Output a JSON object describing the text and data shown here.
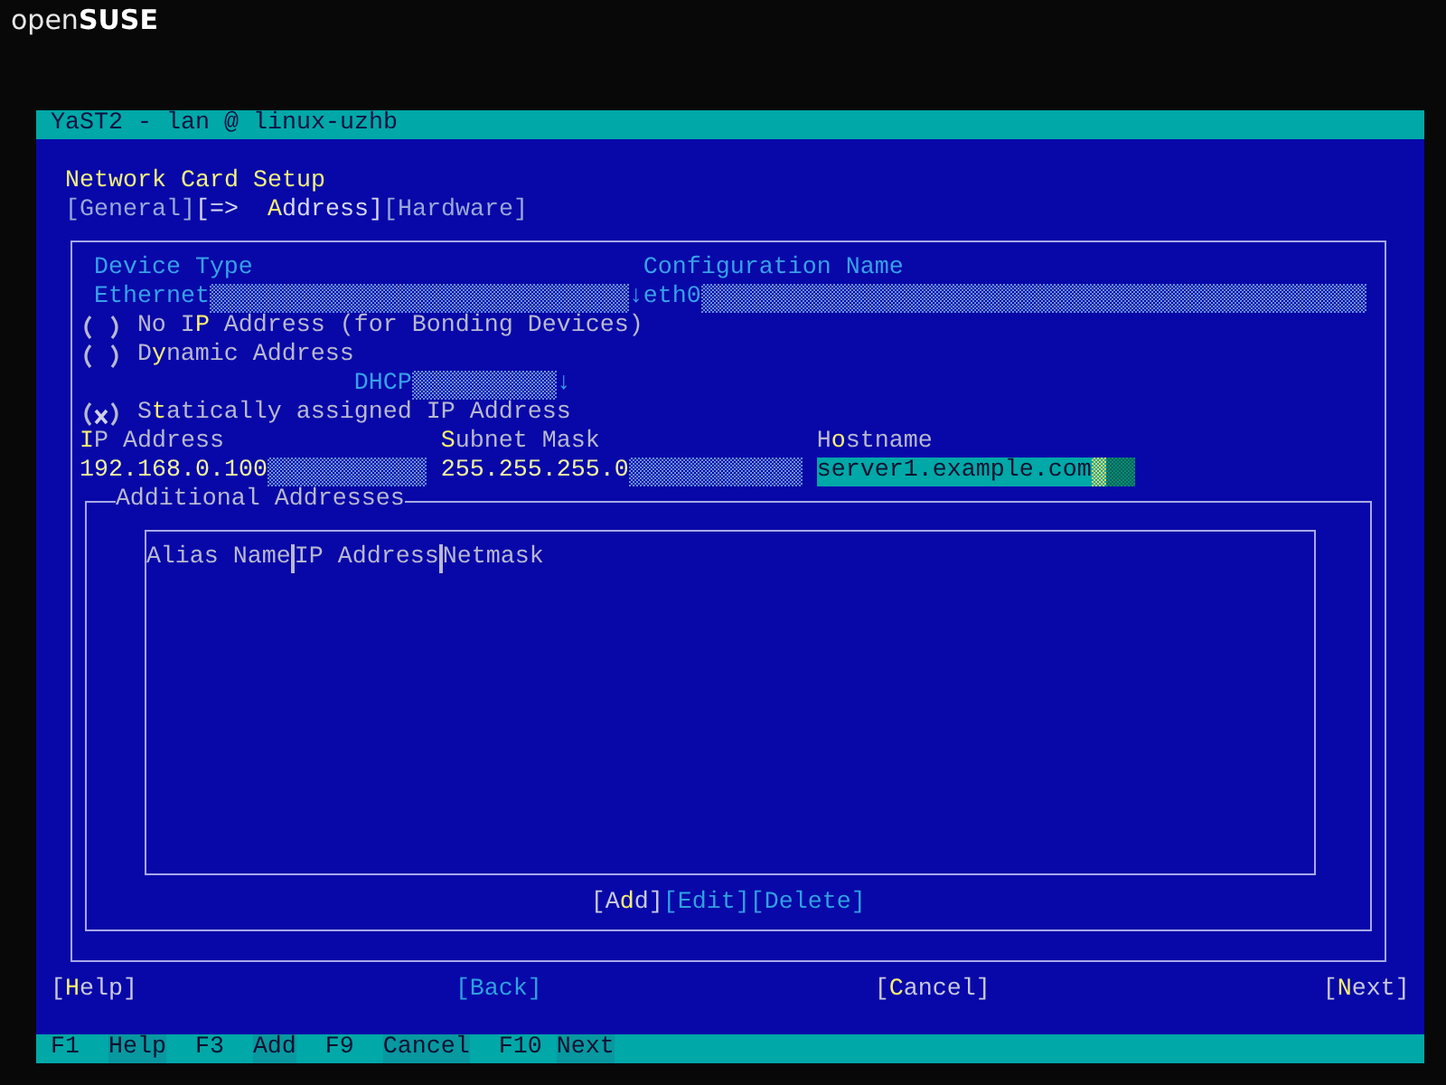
{
  "logo": "open**SUSE**",
  "window": {
    "title": "YaST2 - lan @ linux-uzhb"
  },
  "heading": "Network Card Setup",
  "tabs": [
    {
      "label": "[General]",
      "selected": false
    },
    {
      "label": "[=>  **A**ddress]",
      "selected": true
    },
    {
      "label": "[Hardware]",
      "selected": false
    }
  ],
  "device_type": {
    "label": "Device Type",
    "value": "Ethernet",
    "arrow": "↓"
  },
  "configuration_name": {
    "label": "Configuration Name",
    "value": "eth0"
  },
  "address_modes": [
    {
      "label": "No I**P** Address (for Bonding Devices)",
      "selected": false
    },
    {
      "label": "D**y**namic Address",
      "selected": false
    },
    {
      "label": "S**t**atically assigned IP Address",
      "selected": true
    }
  ],
  "dhcp": {
    "value": "DHCP",
    "arrow": "↓"
  },
  "ip_fields": [
    {
      "label": "**I**P Address",
      "value": "192.168.0.100",
      "focused": false
    },
    {
      "label": "**S**ubnet Mask",
      "value": "255.255.255.0",
      "focused": false
    },
    {
      "label": "H**o**stname",
      "value": "server1.example.com",
      "focused": true
    }
  ],
  "additional_addresses": {
    "title": "Additional Addresses",
    "columns": [
      "Alias Name",
      "IP Address",
      "Netmask"
    ],
    "buttons": [
      {
        "label": "[A**d**d]",
        "disabled": false
      },
      {
        "label": "[Edit]",
        "disabled": true
      },
      {
        "label": "[Delete]",
        "disabled": true
      }
    ]
  },
  "buttons": [
    {
      "label": "[**H**elp]",
      "disabled": false
    },
    {
      "label": "[Back]",
      "disabled": true
    },
    {
      "label": "[**C**ancel]",
      "disabled": false
    },
    {
      "label": "[**N**ext]",
      "disabled": false
    }
  ],
  "function_keys": [
    {
      "key": "F1",
      "label": "Help"
    },
    {
      "key": "F3",
      "label": "Add"
    },
    {
      "key": "F9",
      "label": "Cancel"
    },
    {
      "key": "F10",
      "label": "Next"
    }
  ]
}
